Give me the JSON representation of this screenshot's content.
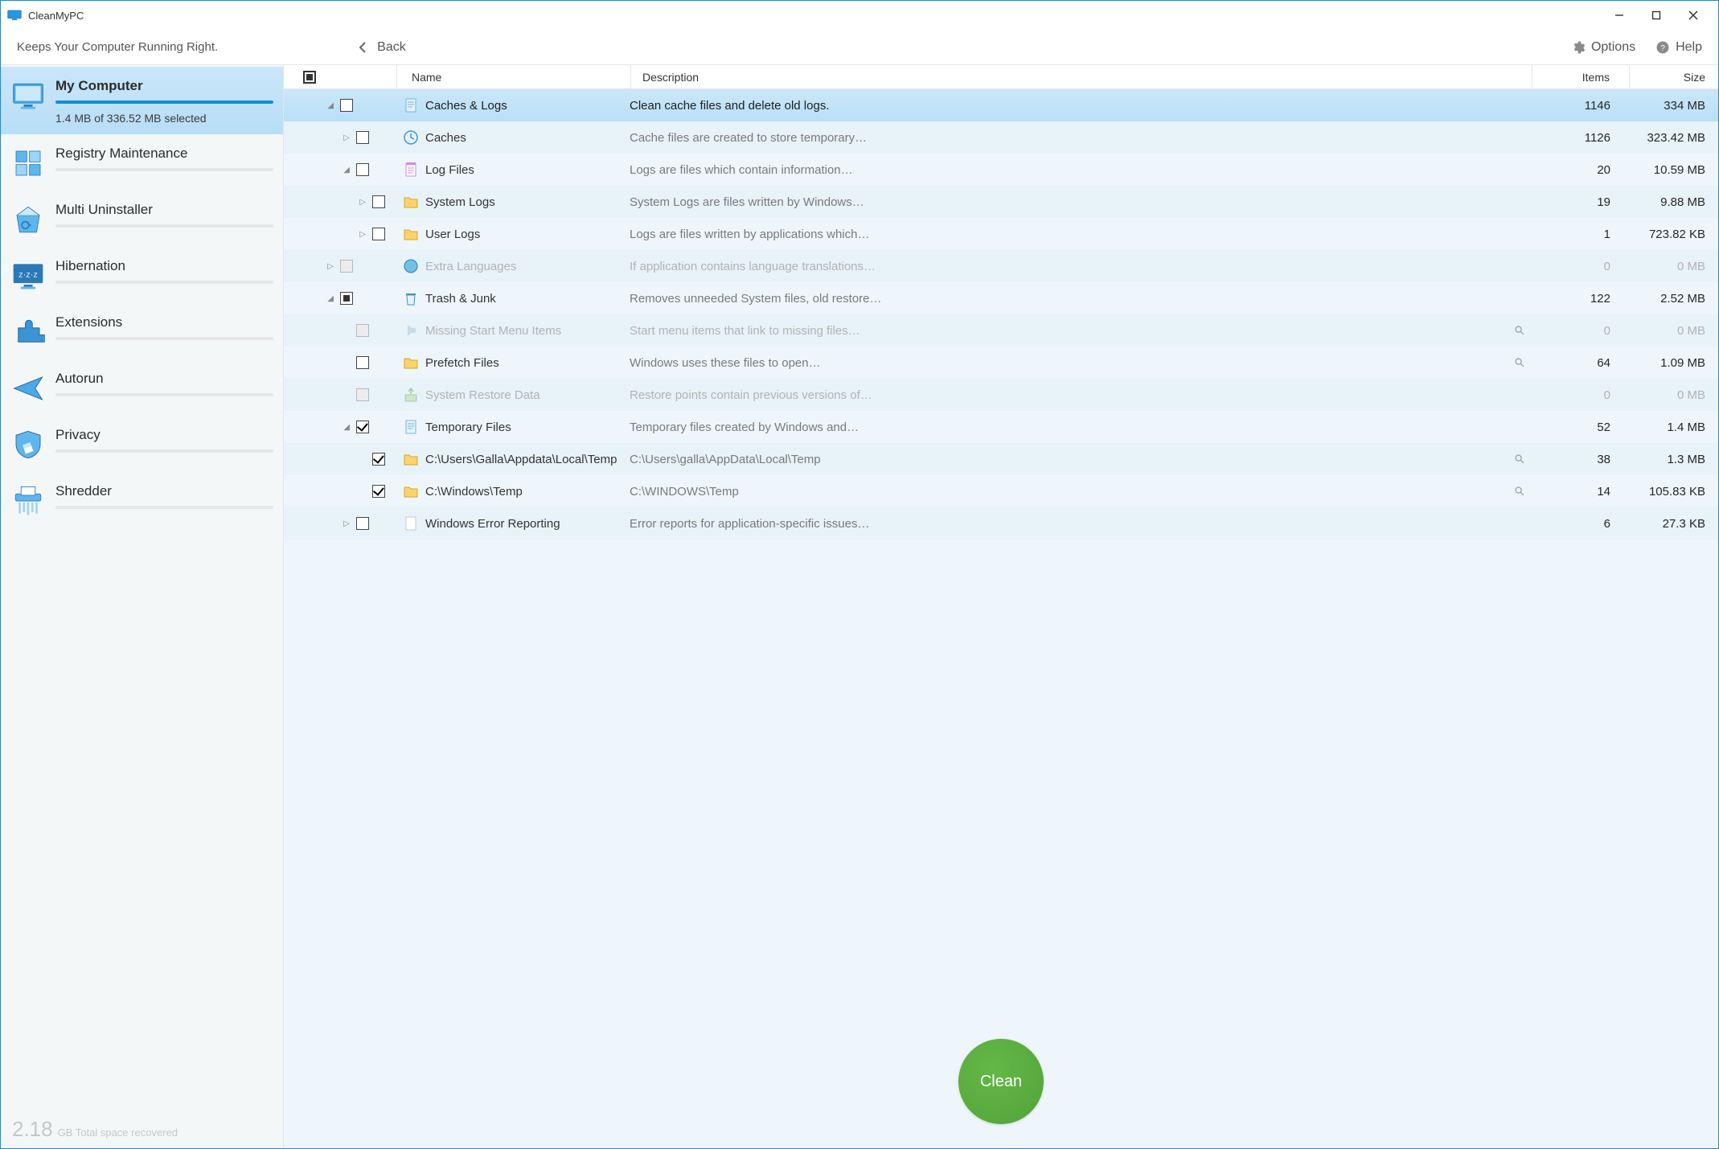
{
  "app": {
    "title": "CleanMyPC",
    "tagline": "Keeps Your Computer Running Right."
  },
  "toolbar": {
    "back": "Back",
    "options": "Options",
    "help": "Help"
  },
  "sidebar": {
    "items": [
      {
        "id": "my-computer",
        "label": "My Computer",
        "sub": "1.4 MB of 336.52 MB selected",
        "selected": true,
        "hasFill": true
      },
      {
        "id": "registry",
        "label": "Registry Maintenance"
      },
      {
        "id": "uninstaller",
        "label": "Multi Uninstaller"
      },
      {
        "id": "hibernation",
        "label": "Hibernation"
      },
      {
        "id": "extensions",
        "label": "Extensions"
      },
      {
        "id": "autorun",
        "label": "Autorun"
      },
      {
        "id": "privacy",
        "label": "Privacy"
      },
      {
        "id": "shredder",
        "label": "Shredder"
      }
    ]
  },
  "columns": {
    "name": "Name",
    "description": "Description",
    "items": "Items",
    "size": "Size"
  },
  "rows": [
    {
      "indent": 1,
      "exp": "open",
      "chk": "empty",
      "icon": "page",
      "name": "Caches & Logs",
      "desc": "Clean cache files and delete old logs.",
      "items": "1146",
      "size": "334 MB",
      "selected": true
    },
    {
      "indent": 2,
      "exp": "closed",
      "chk": "empty",
      "icon": "clock",
      "name": "Caches",
      "desc": "Cache files are created to store temporary…",
      "items": "1126",
      "size": "323.42 MB"
    },
    {
      "indent": 2,
      "exp": "open",
      "chk": "empty",
      "icon": "notes",
      "name": "Log Files",
      "desc": "Logs are files which contain information…",
      "items": "20",
      "size": "10.59 MB"
    },
    {
      "indent": 3,
      "exp": "closed",
      "chk": "empty",
      "icon": "folder-y",
      "name": "System Logs",
      "desc": "System Logs are files written by Windows…",
      "items": "19",
      "size": "9.88 MB"
    },
    {
      "indent": 3,
      "exp": "closed",
      "chk": "empty",
      "icon": "folder-y",
      "name": "User Logs",
      "desc": "Logs are files written by applications which…",
      "items": "1",
      "size": "723.82 KB"
    },
    {
      "indent": 1,
      "exp": "closed",
      "chk": "disabled",
      "icon": "globe",
      "name": "Extra Languages",
      "desc": "If application contains language translations…",
      "items": "0",
      "size": "0 MB",
      "disabled": true
    },
    {
      "indent": 1,
      "exp": "open",
      "chk": "indet",
      "icon": "trash",
      "name": "Trash & Junk",
      "desc": "Removes unneeded System files, old restore…",
      "items": "122",
      "size": "2.52 MB"
    },
    {
      "indent": 2,
      "exp": "none",
      "chk": "disabled",
      "icon": "start",
      "name": "Missing Start Menu Items",
      "desc": "Start menu items that link to missing files…",
      "items": "0",
      "size": "0 MB",
      "disabled": true,
      "mag": true
    },
    {
      "indent": 2,
      "exp": "none",
      "chk": "empty",
      "icon": "folder-y",
      "name": "Prefetch Files",
      "desc": "Windows uses these files to open…",
      "items": "64",
      "size": "1.09 MB",
      "mag": true
    },
    {
      "indent": 2,
      "exp": "none",
      "chk": "disabled",
      "icon": "restore",
      "name": "System Restore Data",
      "desc": "Restore points contain previous versions of…",
      "items": "0",
      "size": "0 MB",
      "disabled": true
    },
    {
      "indent": 2,
      "exp": "open",
      "chk": "checked",
      "icon": "page",
      "name": "Temporary Files",
      "desc": "Temporary files created by Windows and…",
      "items": "52",
      "size": "1.4 MB"
    },
    {
      "indent": 3,
      "exp": "none",
      "chk": "checked",
      "icon": "folder-y",
      "name": "C:\\Users\\Galla\\Appdata\\Local\\Temp",
      "desc": "C:\\Users\\galla\\AppData\\Local\\Temp",
      "items": "38",
      "size": "1.3 MB",
      "mag": true
    },
    {
      "indent": 3,
      "exp": "none",
      "chk": "checked",
      "icon": "folder-y",
      "name": "C:\\Windows\\Temp",
      "desc": "C:\\WINDOWS\\Temp",
      "items": "14",
      "size": "105.83 KB",
      "mag": true
    },
    {
      "indent": 2,
      "exp": "closed",
      "chk": "empty",
      "icon": "blank",
      "name": "Windows Error Reporting",
      "desc": "Error reports for application-specific issues…",
      "items": "6",
      "size": "27.3 KB"
    }
  ],
  "clean_button": "Clean",
  "footer": {
    "recovered_value": "2.18",
    "recovered_unit": "GB Total space recovered"
  }
}
